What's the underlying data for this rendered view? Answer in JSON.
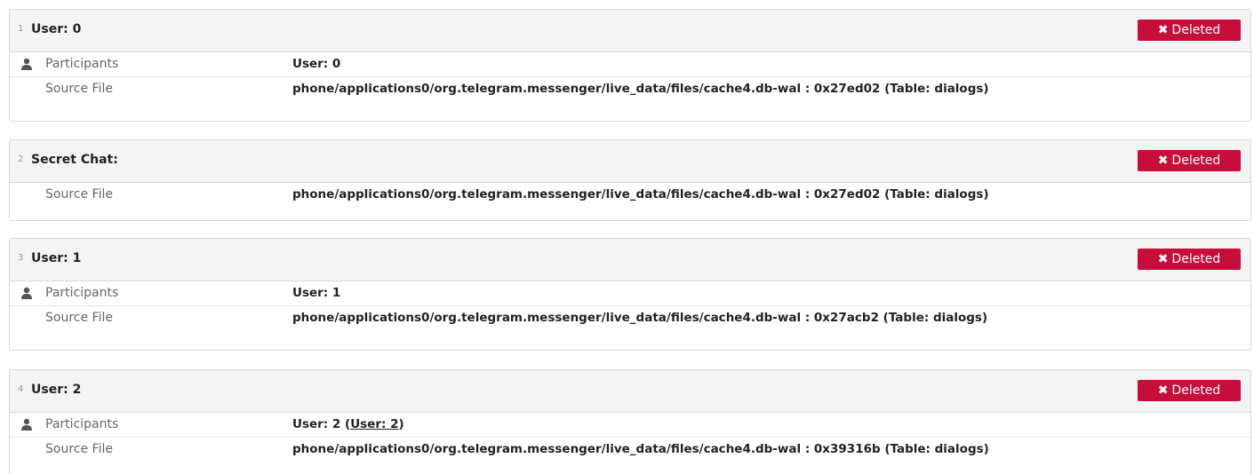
{
  "colors": {
    "badge_bg": "#c70d3a",
    "header_bg": "#f4f4f4"
  },
  "icons": {
    "badge": "x-icon",
    "participants": "person-icon"
  },
  "cards": [
    {
      "index": "1",
      "title": "User: 0",
      "badge": "Deleted",
      "participants_label": "Participants",
      "participants_value": "User: 0",
      "source_label": "Source File",
      "source_value": "phone/applications0/org.telegram.messenger/live_data/files/cache4.db-wal : 0x27ed02 (Table: dialogs)"
    },
    {
      "index": "2",
      "title": "Secret Chat:",
      "badge": "Deleted",
      "source_label": "Source File",
      "source_value": "phone/applications0/org.telegram.messenger/live_data/files/cache4.db-wal : 0x27ed02 (Table: dialogs)"
    },
    {
      "index": "3",
      "title": "User: 1",
      "badge": "Deleted",
      "participants_label": "Participants",
      "participants_value": "User: 1",
      "source_label": "Source File",
      "source_value": "phone/applications0/org.telegram.messenger/live_data/files/cache4.db-wal : 0x27acb2 (Table: dialogs)"
    },
    {
      "index": "4",
      "title": "User: 2",
      "badge": "Deleted",
      "participants_label": "Participants",
      "participants_value": "User: 2",
      "participants_open": " (",
      "participants_link": "User: 2",
      "participants_close": ")",
      "source_label": "Source File",
      "source_value": "phone/applications0/org.telegram.messenger/live_data/files/cache4.db-wal : 0x39316b (Table: dialogs)"
    }
  ]
}
